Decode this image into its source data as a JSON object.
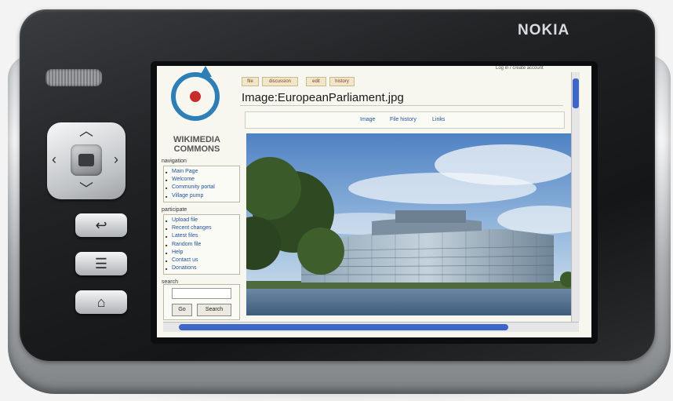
{
  "device": {
    "brand": "NOKIA"
  },
  "hardware_buttons": {
    "back_icon": "return-arrow-icon",
    "menu_icon": "menu-list-icon",
    "home_icon": "home-icon"
  },
  "site": {
    "logo_text": "WIKIMEDIA\nCOMMONS"
  },
  "tabs": [
    "file",
    "discussion",
    "edit",
    "history"
  ],
  "user_links": "Log in / create account",
  "page_title": "Image:EuropeanParliament.jpg",
  "subtabs": [
    "Image",
    "File history",
    "Links"
  ],
  "sidebar": {
    "navigation_label": "navigation",
    "navigation_items": [
      "Main Page",
      "Welcome",
      "Community portal",
      "Village pump"
    ],
    "participate_label": "participate",
    "participate_items": [
      "Upload file",
      "Recent changes",
      "Latest files",
      "Random file",
      "Help",
      "Contact us",
      "Donations"
    ],
    "search_label": "search",
    "search_go": "Go",
    "search_search": "Search"
  },
  "colors": {
    "accent_blue": "#3c67c9",
    "link_blue": "#1f4f9a",
    "logo_blue": "#2d7fb8",
    "logo_red": "#c92a2a"
  }
}
